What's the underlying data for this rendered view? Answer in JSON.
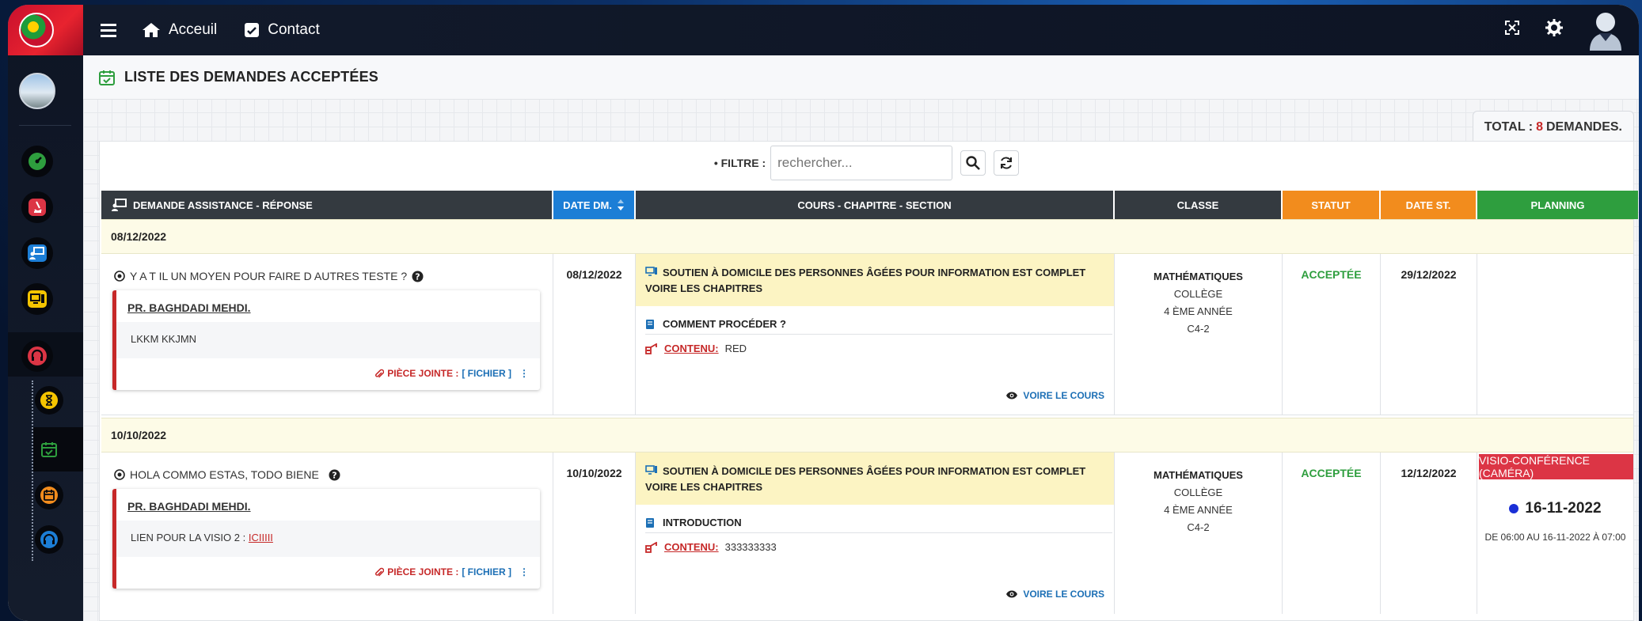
{
  "nav": {
    "acceuil": "Acceuil",
    "contact": "Contact"
  },
  "page": {
    "title": "LISTE DES DEMANDES ACCEPTÉES"
  },
  "total": {
    "prefix": "TOTAL :",
    "count": "8",
    "suffix": "DEMANDES."
  },
  "filter": {
    "label": "• FILTRE :",
    "placeholder": "rechercher..."
  },
  "columns": {
    "demande": "DEMANDE ASSISTANCE - RÉPONSE",
    "date_dm": "DATE DM.",
    "cours": "COURS - CHAPITRE - SECTION",
    "classe": "CLASSE",
    "statut": "STATUT",
    "date_st": "DATE ST.",
    "planning": "PLANNING"
  },
  "groups": [
    {
      "date": "08/12/2022",
      "question": "Y A T IL UN MOYEN POUR FAIRE D AUTRES TESTE ?",
      "prof": "PR. BAGHDADI MEHDI.",
      "answer": "LKKM KKJMN",
      "answer_link": "",
      "pj_label": "PIÈCE JOINTE :",
      "pj_file": "[ FICHIER ]",
      "date_dm": "08/12/2022",
      "course": "SOUTIEN À DOMICILE DES PERSONNES ÂGÉES POUR INFORMATION EST COMPLET VOIRE LES CHAPITRES",
      "chapter": "COMMENT PROCÉDER ?",
      "contenu_label": "CONTENU:",
      "contenu": "RED",
      "voir": "VOIRE LE COURS",
      "matiere": "MATHÉMATIQUES",
      "niveau": "COLLÈGE",
      "annee": "4 ÈME ANNÉE",
      "groupe": "C4-2",
      "statut": "ACCEPTÉE",
      "date_st": "29/12/2022"
    },
    {
      "date": "10/10/2022",
      "question": "HOLA COMMO ESTAS, TODO BIENE",
      "prof": "PR. BAGHDADI MEHDI.",
      "answer": "LIEN POUR LA VISIO 2 :",
      "answer_link": "ICIIIII",
      "pj_label": "PIÈCE JOINTE :",
      "pj_file": "[ FICHIER ]",
      "date_dm": "10/10/2022",
      "course": "SOUTIEN À DOMICILE DES PERSONNES ÂGÉES POUR INFORMATION EST COMPLET VOIRE LES CHAPITRES",
      "chapter": "INTRODUCTION",
      "contenu_label": "CONTENU:",
      "contenu": "333333333",
      "voir": "VOIRE LE COURS",
      "matiere": "MATHÉMATIQUES",
      "niveau": "COLLÈGE",
      "annee": "4 ÈME ANNÉE",
      "groupe": "C4-2",
      "statut": "ACCEPTÉE",
      "date_st": "12/12/2022",
      "planning": {
        "type": "VISIO-CONFÉRENCE (CAMÉRA)",
        "date": "16-11-2022",
        "range": "DE 06:00 AU 16-11-2022 À 07:00"
      }
    }
  ],
  "colors": {
    "accent_red": "#c62828",
    "header_dark": "#343a40",
    "header_blue": "#1c7ed6",
    "header_orange": "#f28c1d",
    "header_green": "#2e9e3e",
    "status_green": "#2e9e3e",
    "group_bg": "#fdfbe7",
    "course_bg": "#fcf4c3",
    "visio_red": "#dc3545"
  },
  "icons": [
    "menu-icon",
    "home-icon",
    "contact-icon",
    "fullscreen-icon",
    "gear-icon",
    "user-avatar-icon",
    "calendar-check-icon",
    "search-icon",
    "refresh-icon",
    "question-circle-icon",
    "paperclip-icon",
    "monitor-icon",
    "book-icon",
    "contenu-icon",
    "eye-icon",
    "sort-icon"
  ]
}
